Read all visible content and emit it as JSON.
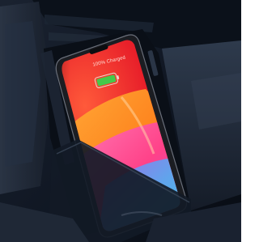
{
  "phone": {
    "charge_status": "100% Charged",
    "battery_level": 1.0
  },
  "colors": {
    "battery_fill": "#45c94a",
    "wallpaper_red": "#e8202a",
    "wallpaper_orange": "#ff8a1e",
    "wallpaper_pink": "#ff3f8e",
    "wallpaper_cyan": "#33d7e6",
    "console_dark": "#101722"
  }
}
